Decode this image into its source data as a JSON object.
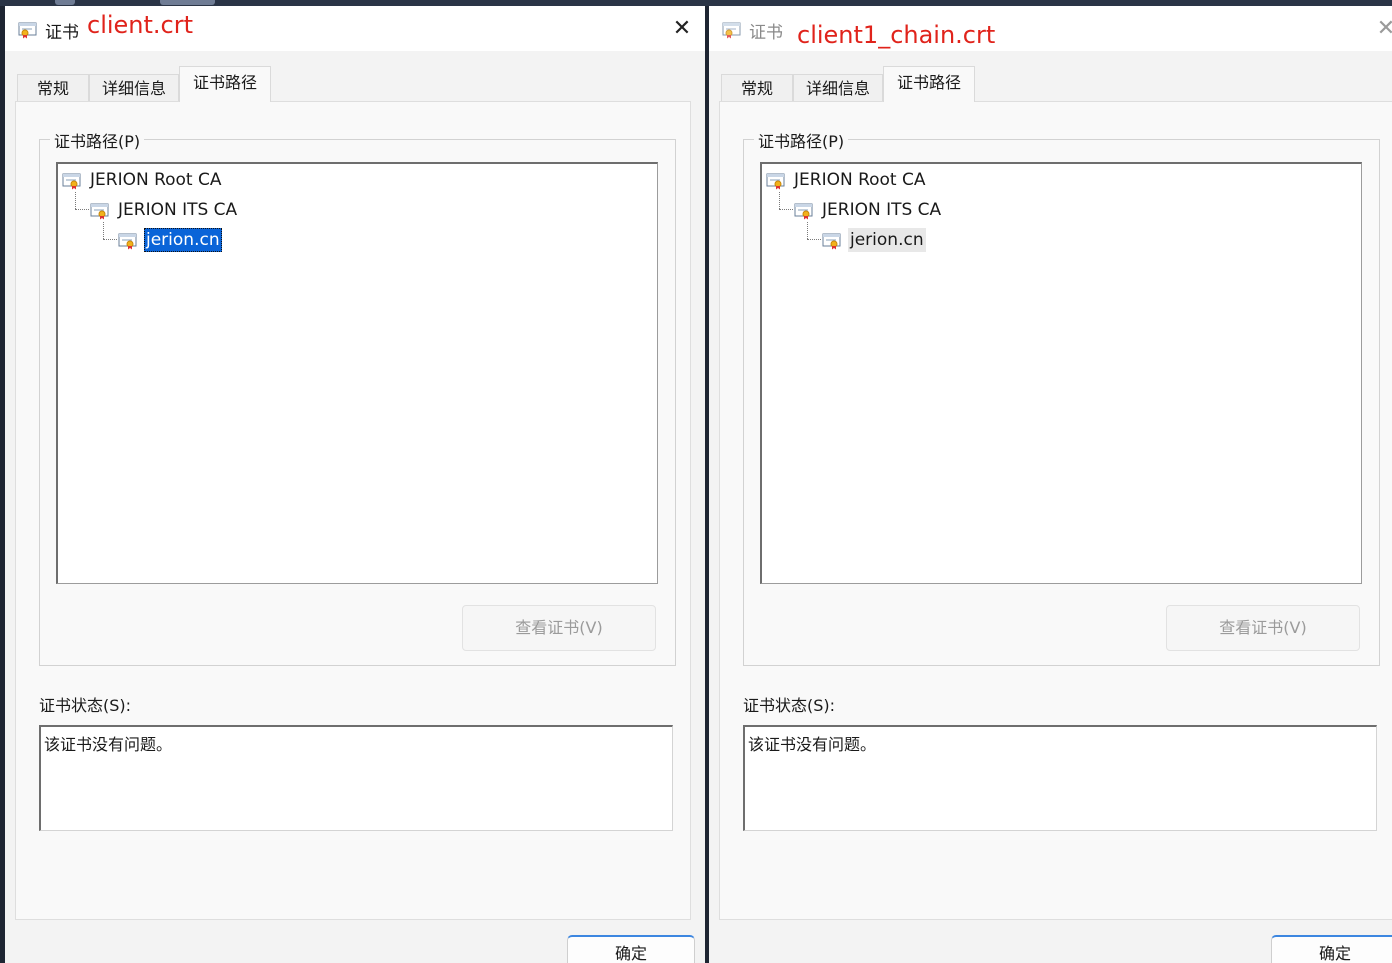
{
  "left_dialog": {
    "title": "证书",
    "annotation": "client.crt",
    "close_glyph": "✕",
    "tabs": [
      "常规",
      "详细信息",
      "证书路径"
    ],
    "active_tab": "证书路径",
    "path_group_title": "证书路径(P)",
    "tree": [
      {
        "label": "JERION Root CA"
      },
      {
        "label": "JERION ITS CA"
      },
      {
        "label": "jerion.cn",
        "state": "selected"
      }
    ],
    "view_cert_button": "查看证书(V)",
    "status_label": "证书状态(S):",
    "status_text": "该证书没有问题。",
    "ok_button": "确定"
  },
  "right_dialog": {
    "title": "证书",
    "annotation": "client1_chain.crt",
    "close_glyph": "✕",
    "tabs": [
      "常规",
      "详细信息",
      "证书路径"
    ],
    "active_tab": "证书路径",
    "path_group_title": "证书路径(P)",
    "tree": [
      {
        "label": "JERION Root CA"
      },
      {
        "label": "JERION ITS CA"
      },
      {
        "label": "jerion.cn",
        "state": "hover"
      }
    ],
    "view_cert_button": "查看证书(V)",
    "status_label": "证书状态(S):",
    "status_text": "该证书没有问题。",
    "ok_button": "确定"
  },
  "colors": {
    "annotation_red": "#e0231b",
    "selection_blue": "#0a64d8",
    "dialog_bg": "#f3f3f3",
    "panel_bg": "#f9f9f9",
    "disabled_text": "#9b9b9b"
  },
  "icons": {
    "certificate": "certificate-icon",
    "close": "close-icon"
  }
}
